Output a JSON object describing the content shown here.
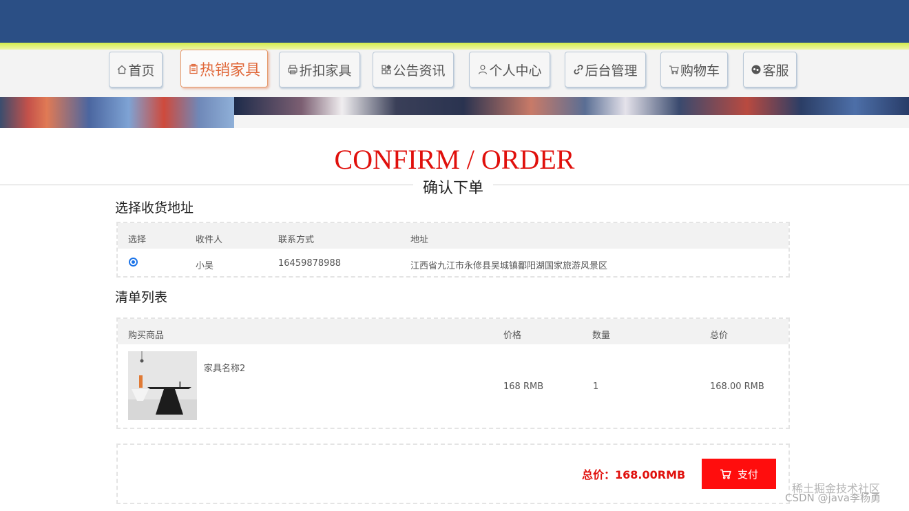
{
  "nav": {
    "items": [
      {
        "label": "首页",
        "icon": "home-icon"
      },
      {
        "label": "热销家具",
        "icon": "clipboard-icon"
      },
      {
        "label": "折扣家具",
        "icon": "printer-icon"
      },
      {
        "label": "公告资讯",
        "icon": "grid-icon"
      },
      {
        "label": "个人中心",
        "icon": "user-icon"
      },
      {
        "label": "后台管理",
        "icon": "link-icon"
      },
      {
        "label": "购物车",
        "icon": "cart-icon"
      },
      {
        "label": "客服",
        "icon": "chat-icon"
      }
    ],
    "active_index": 1,
    "active_color": "#e0683a"
  },
  "page": {
    "title_en": "CONFIRM / ORDER",
    "title_cn": "确认下单"
  },
  "address": {
    "section_title": "选择收货地址",
    "headers": {
      "select": "选择",
      "receiver": "收件人",
      "contact": "联系方式",
      "address": "地址"
    },
    "rows": [
      {
        "selected": true,
        "receiver": "小吴",
        "contact": "16459878988",
        "address": "江西省九江市永修县吴城镇鄱阳湖国家旅游风景区"
      }
    ]
  },
  "items": {
    "section_title": "清单列表",
    "headers": {
      "product": "购买商品",
      "price": "价格",
      "quantity": "数量",
      "total": "总价"
    },
    "rows": [
      {
        "name": "家具名称2",
        "price": "168 RMB",
        "quantity": "1",
        "total": "168.00 RMB"
      }
    ]
  },
  "summary": {
    "total_label": "总价：168.00RMB",
    "pay_label": "支付"
  },
  "watermark": {
    "line1": "稀土掘金技术社区",
    "line2": "CSDN @java李杨勇"
  },
  "colors": {
    "header_blue": "#2b4f85",
    "accent_red": "#e0100c",
    "pay_button": "#ff0d0d",
    "stripe_yellow": "#d4ec4a"
  }
}
